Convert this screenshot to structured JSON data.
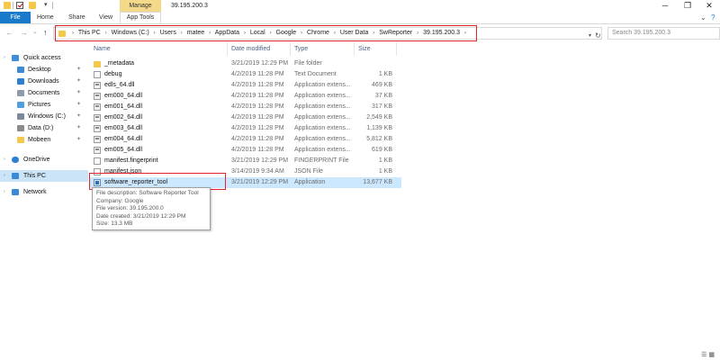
{
  "window": {
    "title": "39.195.200.3",
    "context_tab": "Manage",
    "minimize_glyph": "─",
    "maximize_glyph": "❐",
    "close_glyph": "✕"
  },
  "quick_access_toolbar": {
    "dropdown_glyph": "▾"
  },
  "ribbon": {
    "tabs": [
      "File",
      "Home",
      "Share",
      "View",
      "App Tools"
    ],
    "collapse_glyph": "⌄",
    "help_glyph": "?"
  },
  "navigation": {
    "back_glyph": "←",
    "forward_glyph": "→",
    "recent_glyph": "⌄",
    "up_glyph": "↑",
    "address_dropdown_glyph": "▾",
    "refresh_glyph": "↻",
    "breadcrumb": [
      "This PC",
      "Windows (C:)",
      "Users",
      "matee",
      "AppData",
      "Local",
      "Google",
      "Chrome",
      "User Data",
      "SwReporter",
      "39.195.200.3"
    ],
    "breadcrumb_sep": "›",
    "search_placeholder": "Search 39.195.200.3"
  },
  "sidebar": {
    "items": [
      {
        "label": "Quick access",
        "icon": "star-icon",
        "color": "#3f8fdc",
        "pinned": false
      },
      {
        "label": "Desktop",
        "icon": "desktop-icon",
        "color": "#3a8ad8",
        "pinned": true
      },
      {
        "label": "Downloads",
        "icon": "download-icon",
        "color": "#2f7fd0",
        "pinned": true
      },
      {
        "label": "Documents",
        "icon": "documents-icon",
        "color": "#8d9bab",
        "pinned": true
      },
      {
        "label": "Pictures",
        "icon": "pictures-icon",
        "color": "#4f9fe0",
        "pinned": true
      },
      {
        "label": "Windows (C:)",
        "icon": "drive-icon",
        "color": "#7a8a9a",
        "pinned": true
      },
      {
        "label": "Data (D:)",
        "icon": "drive-icon",
        "color": "#8c8c8c",
        "pinned": true
      },
      {
        "label": "Mobeen",
        "icon": "folder-icon",
        "color": "#f3c84b",
        "pinned": true
      },
      {
        "label": "OneDrive",
        "icon": "cloud-icon",
        "color": "#2b7fd4",
        "pinned": false
      },
      {
        "label": "This PC",
        "icon": "computer-icon",
        "color": "#3a8ad8",
        "pinned": false
      },
      {
        "label": "Network",
        "icon": "network-icon",
        "color": "#3a8ad8",
        "pinned": false
      }
    ],
    "pin_glyph": "✦",
    "expander_glyph": "›"
  },
  "columns": {
    "name": "Name",
    "date_modified": "Date modified",
    "type": "Type",
    "size": "Size"
  },
  "files": [
    {
      "name": "_metadata",
      "date": "3/21/2019 12:29 PM",
      "type": "File folder",
      "size": "",
      "icon": "folder-icon"
    },
    {
      "name": "debug",
      "date": "4/2/2019 11:28 PM",
      "type": "Text Document",
      "size": "1 KB",
      "icon": "text-file-icon"
    },
    {
      "name": "edls_64.dll",
      "date": "4/2/2019 11:28 PM",
      "type": "Application extens...",
      "size": "469 KB",
      "icon": "dll-file-icon"
    },
    {
      "name": "em000_64.dll",
      "date": "4/2/2019 11:28 PM",
      "type": "Application extens...",
      "size": "37 KB",
      "icon": "dll-file-icon"
    },
    {
      "name": "em001_64.dll",
      "date": "4/2/2019 11:28 PM",
      "type": "Application extens...",
      "size": "317 KB",
      "icon": "dll-file-icon"
    },
    {
      "name": "em002_64.dll",
      "date": "4/2/2019 11:28 PM",
      "type": "Application extens...",
      "size": "2,549 KB",
      "icon": "dll-file-icon"
    },
    {
      "name": "em003_64.dll",
      "date": "4/2/2019 11:28 PM",
      "type": "Application extens...",
      "size": "1,139 KB",
      "icon": "dll-file-icon"
    },
    {
      "name": "em004_64.dll",
      "date": "4/2/2019 11:28 PM",
      "type": "Application extens...",
      "size": "5,812 KB",
      "icon": "dll-file-icon"
    },
    {
      "name": "em005_64.dll",
      "date": "4/2/2019 11:28 PM",
      "type": "Application extens...",
      "size": "619 KB",
      "icon": "dll-file-icon"
    },
    {
      "name": "manifest.fingerprint",
      "date": "3/21/2019 12:29 PM",
      "type": "FINGERPRINT File",
      "size": "1 KB",
      "icon": "file-icon"
    },
    {
      "name": "manifest.json",
      "date": "3/14/2019 9:34 AM",
      "type": "JSON File",
      "size": "1 KB",
      "icon": "file-icon"
    },
    {
      "name": "software_reporter_tool",
      "date": "3/21/2019 12:29 PM",
      "type": "Application",
      "size": "13,677 KB",
      "icon": "application-icon",
      "selected": true
    }
  ],
  "tooltip": {
    "lines": [
      "File description: Software Reporter Tool",
      "Company: Google",
      "File version: 39.195.200.0",
      "Date created: 3/21/2019 12:29 PM",
      "Size: 13.3 MB"
    ]
  },
  "status_bar": {
    "details_view_glyph": "☰",
    "icons_view_glyph": "▦"
  }
}
